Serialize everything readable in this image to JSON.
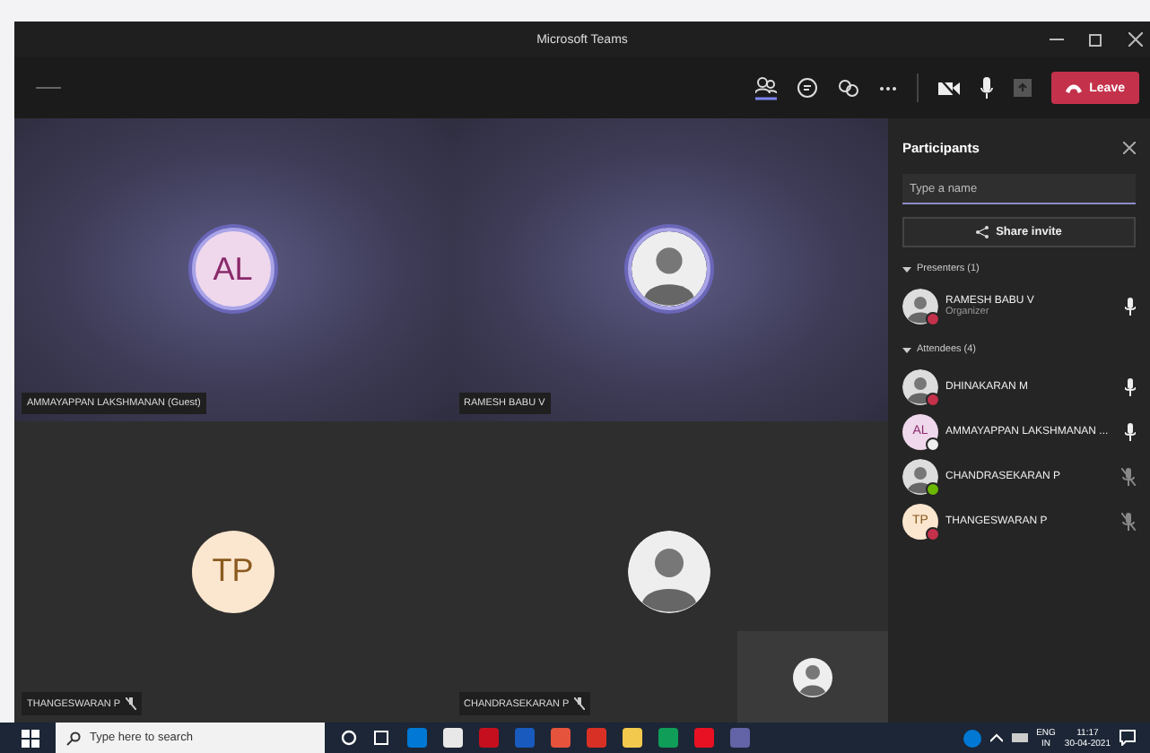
{
  "window": {
    "title": "Microsoft Teams"
  },
  "toolbar": {
    "leave_label": "Leave"
  },
  "tiles": [
    {
      "name": "AMMAYAPPAN LAKSHMANAN (Guest)",
      "kind": "initials",
      "initials": "AL",
      "muted": false
    },
    {
      "name": "RAMESH BABU V",
      "kind": "photo",
      "muted": false
    },
    {
      "name": "THANGESWARAN P",
      "kind": "initials",
      "initials": "TP",
      "muted": true
    },
    {
      "name": "CHANDRASEKARAN P",
      "kind": "photo",
      "muted": true
    }
  ],
  "participants": {
    "title": "Participants",
    "search": {
      "placeholder": "Type a name"
    },
    "share_label": "Share invite",
    "groups": [
      {
        "label": "Presenters (1)",
        "members": [
          {
            "name": "RAMESH BABU V",
            "role": "Organizer",
            "kind": "photo",
            "color": "#c4314b",
            "muted": false
          }
        ]
      },
      {
        "label": "Attendees (4)",
        "members": [
          {
            "name": "DHINAKARAN M",
            "kind": "photo",
            "color": "#c4314b",
            "muted": false
          },
          {
            "name": "AMMAYAPPAN LAKSHMANAN ...",
            "kind": "initials",
            "initials": "AL",
            "color": "#f0f0f0",
            "muted": false
          },
          {
            "name": "CHANDRASEKARAN P",
            "kind": "photo",
            "color": "#6bb700",
            "muted": true
          },
          {
            "name": "THANGESWARAN P",
            "kind": "initials",
            "initials": "TP",
            "color": "#c4314b",
            "muted": true
          }
        ]
      }
    ]
  },
  "taskbar": {
    "search": {
      "placeholder": "Type here to search"
    },
    "language": "ENG",
    "region": "IN",
    "time": "11:17",
    "date": "30-04-2021"
  }
}
